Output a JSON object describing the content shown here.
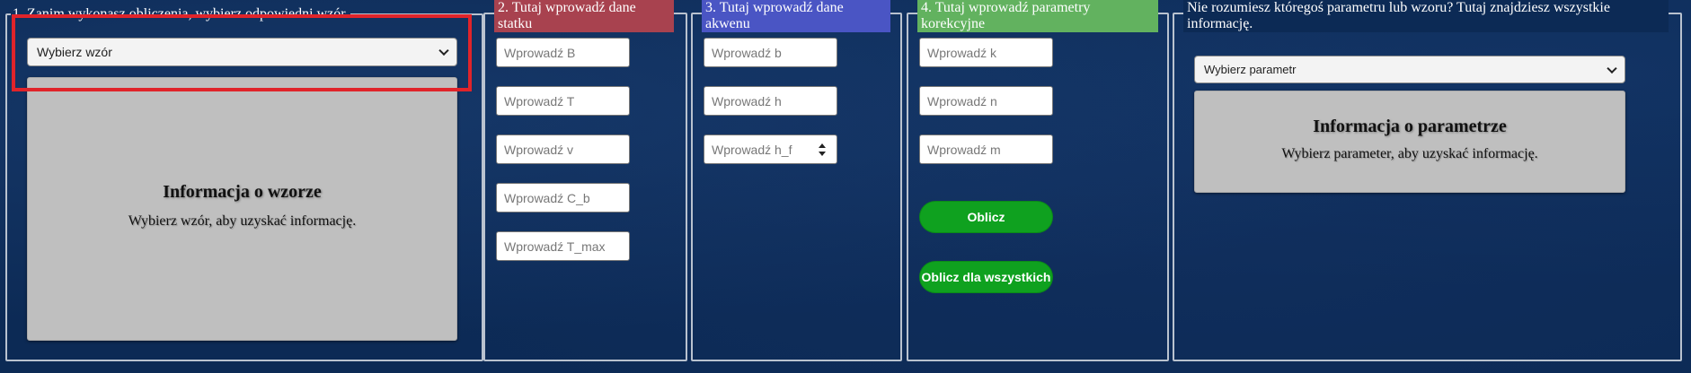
{
  "section1": {
    "legend": "1. Zanim wykonasz obliczenia, wybierz odpowiedni wzór.",
    "select_value": "Wybierz wzór",
    "info_title": "Informacja o wzorze",
    "info_text": "Wybierz wzór, aby uzyskać informację."
  },
  "section2": {
    "title": "2. Tutaj wprowadź dane statku",
    "color": "#a8424f",
    "inputs": [
      "Wprowadź B",
      "Wprowadź T",
      "Wprowadź v",
      "Wprowadź C_b",
      "Wprowadź T_max"
    ]
  },
  "section3": {
    "title": "3. Tutaj wprowadź dane akwenu",
    "color": "#4a55c4",
    "inputs": [
      "Wprowadź b",
      "Wprowadź h",
      "Wprowadź h_f"
    ]
  },
  "section4": {
    "title": "4. Tutaj wprowadź parametry korekcyjne",
    "color": "#62b25f",
    "inputs": [
      "Wprowadź k",
      "Wprowadź n",
      "Wprowadź m"
    ],
    "buttons": {
      "calculate": "Oblicz",
      "calculate_all": "Oblicz dla wszystkich"
    }
  },
  "section5": {
    "title": "Nie rozumiesz któregoś parametru lub wzoru? Tutaj znajdziesz wszystkie informację.",
    "select_value": "Wybierz parametr",
    "info_title": "Informacja o parametrze",
    "info_text": "Wybierz parameter, aby uzyskać informację."
  }
}
